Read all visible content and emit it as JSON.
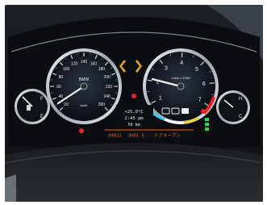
{
  "speedometer": {
    "brand": "BMW",
    "ticks": [
      "20",
      "40",
      "60",
      "80",
      "100",
      "120",
      "140",
      "160",
      "180",
      "200",
      "220",
      "240",
      "260"
    ],
    "unit": "km/h"
  },
  "tachometer": {
    "ticks": [
      "1",
      "2",
      "3",
      "4",
      "5",
      "6",
      "7"
    ],
    "unit": "1/min x 1000"
  },
  "fuel_gauge": {
    "marks": [
      "F",
      "E"
    ]
  },
  "temp_gauge": {
    "marks": [
      "H",
      "C"
    ]
  },
  "info_display": {
    "temperature": "+25.0°C",
    "time": "2:45 pm",
    "range": "50 km",
    "odometer": "89022",
    "trip": "4901.5",
    "message": "ドアオープン",
    "gear": "P"
  },
  "colors": {
    "needle": "#f2f2f2",
    "warning_red": "#e8222a",
    "turn_signal_amber": "#e7a71d",
    "shift_lights": [
      "#3cc6e8",
      "#ffffff",
      "#f0d21c",
      "#e8222a"
    ]
  }
}
